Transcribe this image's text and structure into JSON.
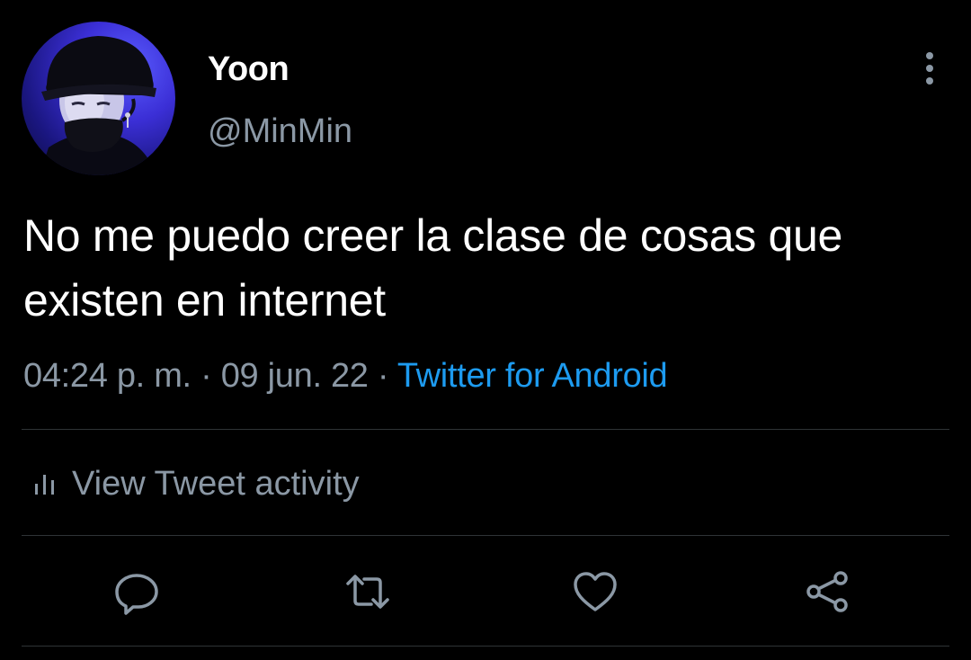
{
  "user": {
    "display_name": "Yoon",
    "handle": "@MinMin"
  },
  "tweet": {
    "text": "No me puedo creer la clase de cosas que existen en internet",
    "time": "04:24 p. m.",
    "separator": "·",
    "date": "09 jun. 22",
    "source": "Twitter for Android"
  },
  "activity": {
    "label": "View Tweet activity"
  },
  "icons": {
    "more": "more-vertical-icon",
    "activity": "bar-chart-icon",
    "reply": "reply-icon",
    "retweet": "retweet-icon",
    "like": "heart-icon",
    "share": "share-icon"
  },
  "colors": {
    "background": "#000000",
    "text": "#ffffff",
    "secondary": "#8b98a5",
    "link": "#1d9bf0",
    "divider": "#2f3336"
  }
}
